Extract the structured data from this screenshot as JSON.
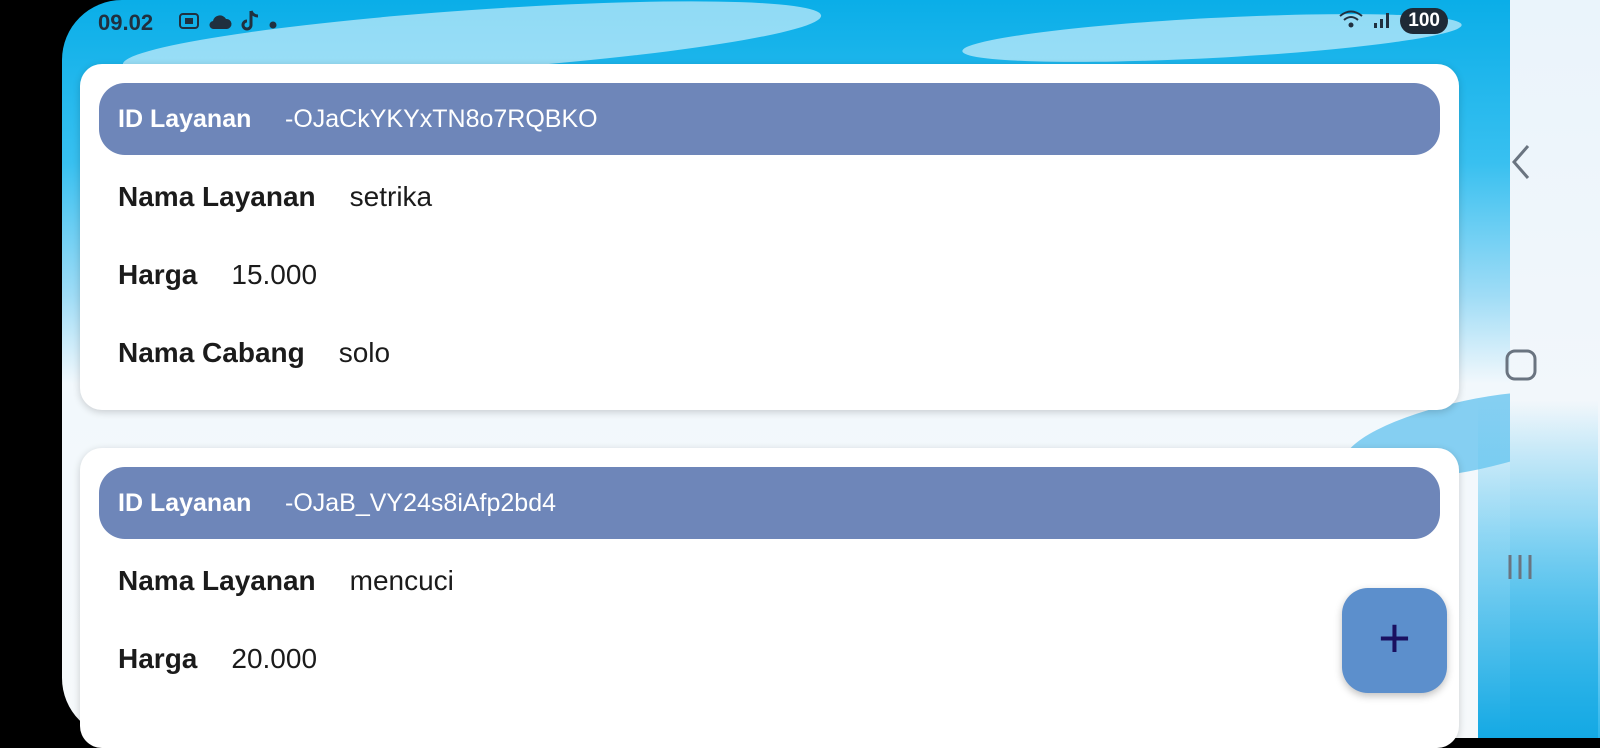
{
  "status_bar": {
    "time": "09.02",
    "battery": "100",
    "left_icons": [
      "screenshot-icon",
      "cloud-icon",
      "tiktok-icon",
      "dot-icon"
    ],
    "right_icons": [
      "wifi-icon",
      "signal-icon",
      "battery-icon"
    ]
  },
  "cards": [
    {
      "id_label": "ID Layanan",
      "id_value": "-OJaCkYKYxTN8o7RQBKO",
      "nama_label": "Nama Layanan",
      "nama_value": "setrika",
      "harga_label": "Harga",
      "harga_value": "15.000",
      "cabang_label": "Nama Cabang",
      "cabang_value": "solo"
    },
    {
      "id_label": "ID Layanan",
      "id_value": "-OJaB_VY24s8iAfp2bd4",
      "nama_label": "Nama Layanan",
      "nama_value": "mencuci",
      "harga_label": "Harga",
      "harga_value": "20.000"
    }
  ],
  "fab": {
    "icon": "plus-icon",
    "label": "+"
  },
  "nav": {
    "back": "back-icon",
    "home": "home-icon",
    "recent": "recent-apps-icon"
  },
  "colors": {
    "header_bg": "#6e86b9",
    "fab_bg": "#5c8fcc",
    "sky": "#0aaee8"
  }
}
